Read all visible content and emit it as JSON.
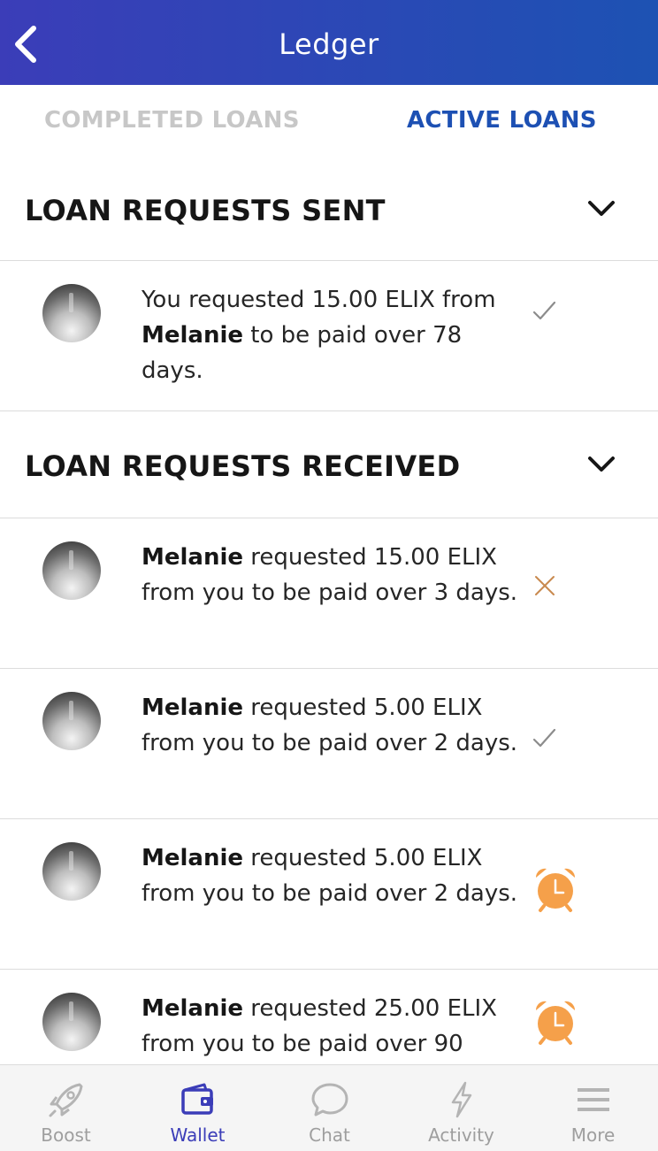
{
  "header": {
    "title": "Ledger",
    "back_icon": "chevron-left-icon"
  },
  "tabs": {
    "completed": "COMPLETED LOANS",
    "active": "ACTIVE LOANS",
    "selected": "active"
  },
  "sections": {
    "sent": {
      "title": "LOAN REQUESTS SENT"
    },
    "received": {
      "title": "LOAN REQUESTS RECEIVED"
    }
  },
  "sent_items": [
    {
      "prefix": "You requested 15.00 ELIX from ",
      "name": "Melanie",
      "suffix": " to be paid over 78 days.",
      "status": "accepted",
      "status_icon": "check-icon"
    }
  ],
  "received_items": [
    {
      "name": "Melanie",
      "text": " requested 15.00 ELIX from you to be paid over 3 days.",
      "status": "declined",
      "status_icon": "close-icon"
    },
    {
      "name": "Melanie",
      "text": " requested 5.00 ELIX from you to be paid over 2 days.",
      "status": "accepted",
      "status_icon": "check-icon"
    },
    {
      "name": "Melanie",
      "text": " requested 5.00 ELIX from you to be paid over 2 days.",
      "status": "pending",
      "status_icon": "alarm-clock-icon"
    },
    {
      "name": "Melanie",
      "text": " requested 25.00 ELIX from you to be paid over 90",
      "status": "pending",
      "status_icon": "alarm-clock-icon"
    }
  ],
  "bottom_nav": [
    {
      "label": "Boost",
      "icon": "rocket-icon"
    },
    {
      "label": "Wallet",
      "icon": "wallet-icon",
      "active": true
    },
    {
      "label": "Chat",
      "icon": "chat-bubble-icon"
    },
    {
      "label": "Activity",
      "icon": "lightning-icon"
    },
    {
      "label": "More",
      "icon": "menu-icon"
    }
  ],
  "colors": {
    "header_start": "#3b3db8",
    "header_end": "#1d52b3",
    "active_tab": "#1d50b3",
    "alarm": "#f5a04a",
    "decline": "#c98a4f"
  }
}
